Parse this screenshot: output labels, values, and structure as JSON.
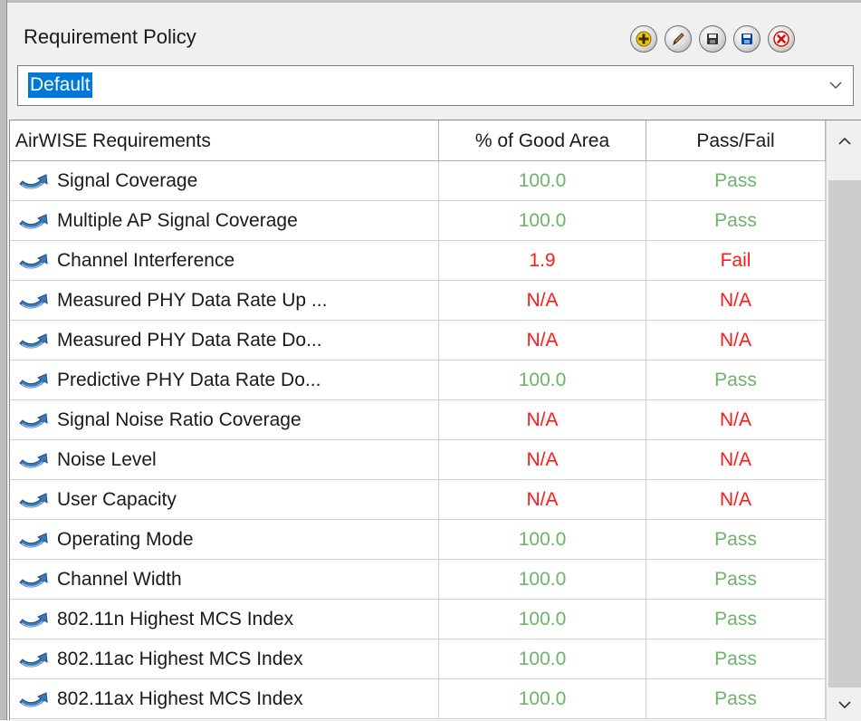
{
  "header": {
    "title": "Requirement Policy",
    "toolbar": [
      {
        "name": "add-policy-button",
        "icon": "add-icon",
        "color": "#f1c40f"
      },
      {
        "name": "edit-policy-button",
        "icon": "pencil-icon",
        "color": "#e67e22"
      },
      {
        "name": "save-policy-button",
        "icon": "save-icon",
        "color": "#333333"
      },
      {
        "name": "save-as-policy-button",
        "icon": "save-as-icon",
        "color": "#0047ab"
      },
      {
        "name": "delete-policy-button",
        "icon": "delete-icon",
        "color": "#e60000"
      }
    ]
  },
  "policy_select": {
    "selected": "Default",
    "chevron_icon": "chevron-down-icon"
  },
  "grid": {
    "columns": [
      "AirWISE Requirements",
      "% of Good Area",
      "Pass/Fail"
    ],
    "rows": [
      {
        "requirement": "Signal Coverage",
        "good_area": "100.0",
        "result": "Pass",
        "status": "pass"
      },
      {
        "requirement": "Multiple AP Signal Coverage",
        "good_area": "100.0",
        "result": "Pass",
        "status": "pass"
      },
      {
        "requirement": "Channel Interference",
        "good_area": "1.9",
        "result": "Fail",
        "status": "fail"
      },
      {
        "requirement": "Measured PHY Data Rate Up ...",
        "good_area": "N/A",
        "result": "N/A",
        "status": "fail"
      },
      {
        "requirement": "Measured PHY Data Rate Do...",
        "good_area": "N/A",
        "result": "N/A",
        "status": "fail"
      },
      {
        "requirement": "Predictive PHY Data Rate Do...",
        "good_area": "100.0",
        "result": "Pass",
        "status": "pass"
      },
      {
        "requirement": "Signal Noise Ratio Coverage",
        "good_area": "N/A",
        "result": "N/A",
        "status": "fail"
      },
      {
        "requirement": "Noise Level",
        "good_area": "N/A",
        "result": "N/A",
        "status": "fail"
      },
      {
        "requirement": "User Capacity",
        "good_area": "N/A",
        "result": "N/A",
        "status": "fail"
      },
      {
        "requirement": "Operating Mode",
        "good_area": "100.0",
        "result": "Pass",
        "status": "pass"
      },
      {
        "requirement": "Channel Width",
        "good_area": "100.0",
        "result": "Pass",
        "status": "pass"
      },
      {
        "requirement": "802.11n Highest MCS Index",
        "good_area": "100.0",
        "result": "Pass",
        "status": "pass"
      },
      {
        "requirement": "802.11ac Highest MCS Index",
        "good_area": "100.0",
        "result": "Pass",
        "status": "pass"
      },
      {
        "requirement": "802.11ax Highest MCS Index",
        "good_area": "100.0",
        "result": "Pass",
        "status": "pass"
      }
    ],
    "row_icon": "airwise-requirement-icon",
    "colors": {
      "pass": "#6cb46c",
      "fail": "#ff1a1a",
      "selection": "#0078d7"
    }
  },
  "scrollbar": {
    "up_icon": "chevron-up-icon",
    "down_icon": "chevron-down-icon"
  }
}
